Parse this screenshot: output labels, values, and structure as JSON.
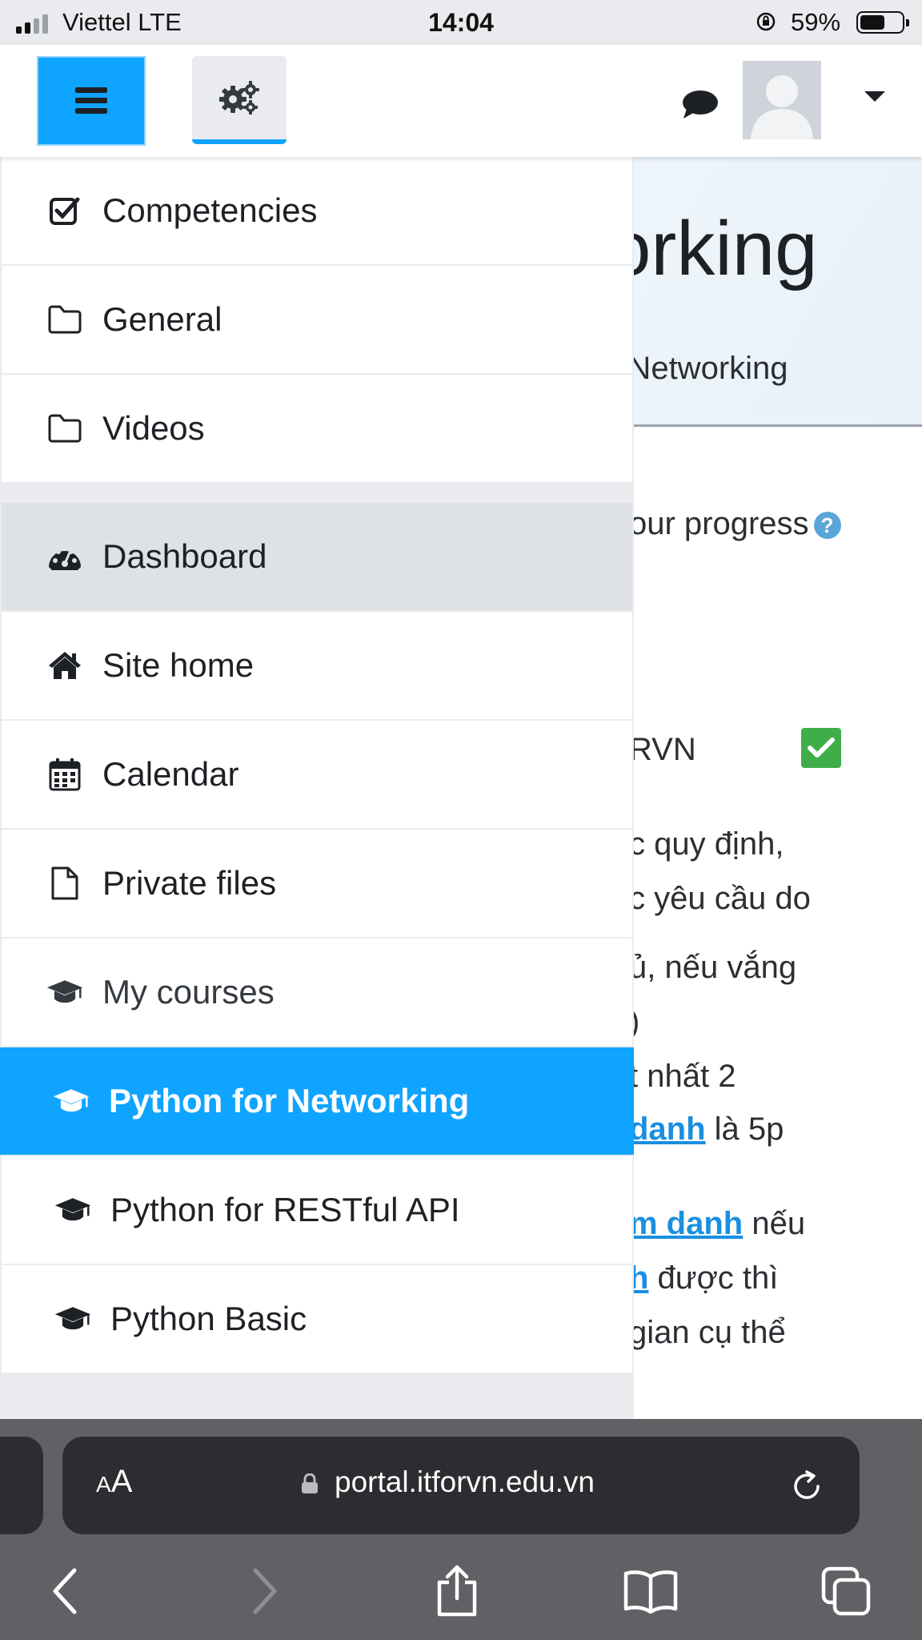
{
  "status_bar": {
    "carrier": "Viettel   LTE",
    "time": "14:04",
    "battery_percent": "59%",
    "battery_level": 0.59
  },
  "navbar": {
    "menu_icon": "hamburger-icon",
    "settings_icon": "gears-icon",
    "messages_icon": "chat-bubble-icon",
    "user_menu_icon": "caret-down-icon"
  },
  "background_page": {
    "header_title_fragment": "orking",
    "header_subtitle_fragment": "r Networking",
    "progress_text": "our progress",
    "help_icon": "?",
    "item_text": "RVN",
    "lines": [
      "c quy định,",
      "c yêu cầu do",
      "ủ, nếu vắng",
      ")",
      "t nhất 2"
    ],
    "link_line_1": {
      "link": "danh",
      "rest": " là 5p"
    },
    "link_line_2": {
      "link": "m danh",
      "rest": " nếu"
    },
    "link_line_3": {
      "link": "h",
      "rest": " được thì"
    },
    "cut_line": "gian cụ thể"
  },
  "drawer": {
    "items": [
      {
        "label": "Competencies",
        "icon": "checkbox-icon"
      },
      {
        "label": "General",
        "icon": "folder-icon"
      },
      {
        "label": "Videos",
        "icon": "folder-icon"
      },
      {
        "label": "Dashboard",
        "icon": "dashboard-gauge-icon"
      },
      {
        "label": "Site home",
        "icon": "home-icon"
      },
      {
        "label": "Calendar",
        "icon": "calendar-icon"
      },
      {
        "label": "Private files",
        "icon": "file-icon"
      },
      {
        "label": "My courses",
        "icon": "graduation-cap-icon"
      },
      {
        "label": "Python for Networking",
        "icon": "graduation-cap-icon"
      },
      {
        "label": "Python for RESTful API",
        "icon": "graduation-cap-icon"
      },
      {
        "label": "Python Basic",
        "icon": "graduation-cap-icon"
      }
    ]
  },
  "safari": {
    "text_size_label": "AA",
    "url": "portal.itforvn.edu.vn",
    "toolbar": [
      "back-icon",
      "forward-icon",
      "share-icon",
      "bookmarks-icon",
      "tabs-icon"
    ]
  },
  "colors": {
    "accent": "#0fa4ff",
    "drawer_active": "#dee2e6",
    "check_green": "#3fae49",
    "link": "#1a8fe0"
  }
}
